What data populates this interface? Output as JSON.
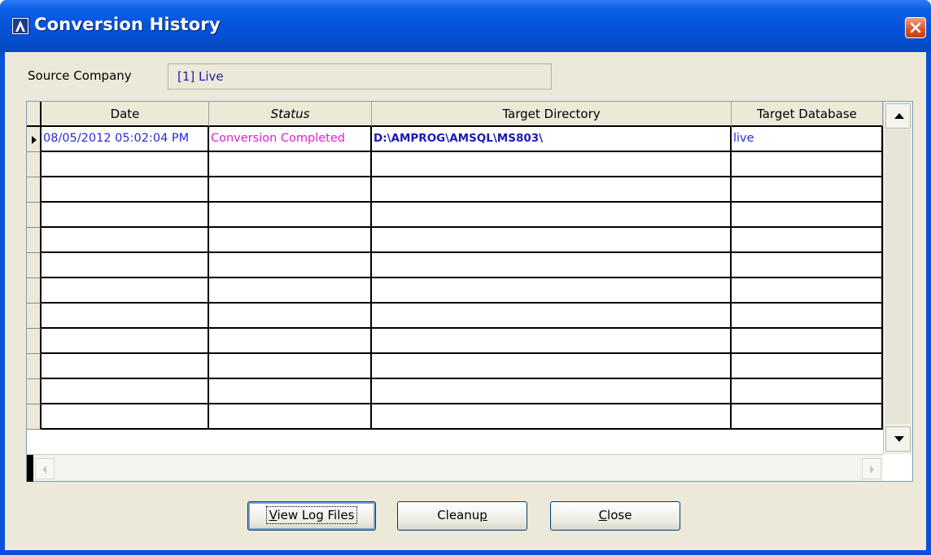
{
  "window": {
    "title": "Conversion History"
  },
  "source": {
    "label": "Source Company",
    "value": "[1] Live"
  },
  "grid": {
    "columns": [
      "Date",
      "Status",
      "Target Directory",
      "Target Database"
    ],
    "rows": [
      {
        "date": "08/05/2012  05:02:04 PM",
        "status": "Conversion Completed",
        "target_directory": "D:\\AMPROG\\AMSQL\\MS803\\",
        "target_database": "live"
      }
    ],
    "empty_rows": 12
  },
  "buttons": {
    "view_log": {
      "pre": "",
      "mnemonic": "V",
      "post": "iew Log Files"
    },
    "cleanup": {
      "pre": "Cleanu",
      "mnemonic": "p",
      "post": ""
    },
    "close": {
      "pre": "",
      "mnemonic": "C",
      "post": "lose"
    }
  },
  "colors": {
    "title_bar": "#0552d8",
    "dialog_bg": "#ece9d8",
    "date_text": "#2b2bd6",
    "status_text": "#e020d0",
    "directory_text": "#1a1ab8"
  },
  "icons": {
    "app": "app-logo-icon",
    "close": "close-icon",
    "scroll_up": "scroll-up-arrow-icon",
    "scroll_down": "scroll-down-arrow-icon",
    "scroll_left": "scroll-left-arrow-icon",
    "scroll_right": "scroll-right-arrow-icon",
    "current_row": "current-row-pointer-icon"
  }
}
